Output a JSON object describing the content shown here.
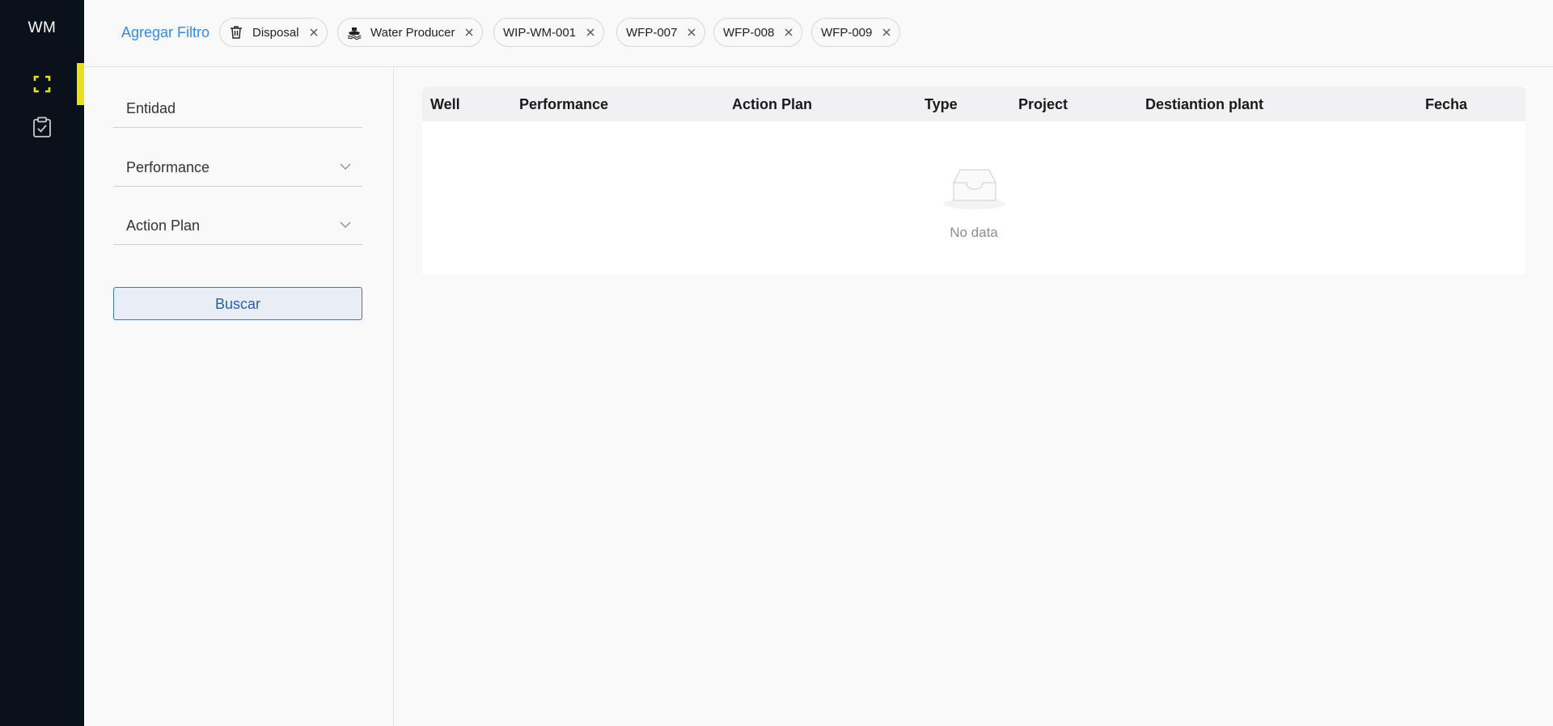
{
  "sidebar": {
    "logo": "WM",
    "items": [
      {
        "icon": "scan-frame-icon",
        "active": true
      },
      {
        "icon": "clipboard-check-icon",
        "active": false
      }
    ],
    "accent_color": "#e8e01e"
  },
  "filters": {
    "add_label": "Agregar Filtro",
    "chips": [
      {
        "label": "Disposal",
        "icon": "trash-icon"
      },
      {
        "label": "Water Producer",
        "icon": "water-ship-icon"
      },
      {
        "label": "WIP-WM-001"
      },
      {
        "label": "WFP-007"
      },
      {
        "label": "WFP-008"
      },
      {
        "label": "WFP-009"
      }
    ]
  },
  "form": {
    "entidad_label": "Entidad",
    "performance_label": "Performance",
    "action_plan_label": "Action Plan",
    "search_button": "Buscar"
  },
  "table": {
    "columns": [
      "Well",
      "Performance",
      "Action Plan",
      "Type",
      "Project",
      "Destiantion plant",
      "Fecha"
    ],
    "rows": [],
    "empty_text": "No data"
  }
}
